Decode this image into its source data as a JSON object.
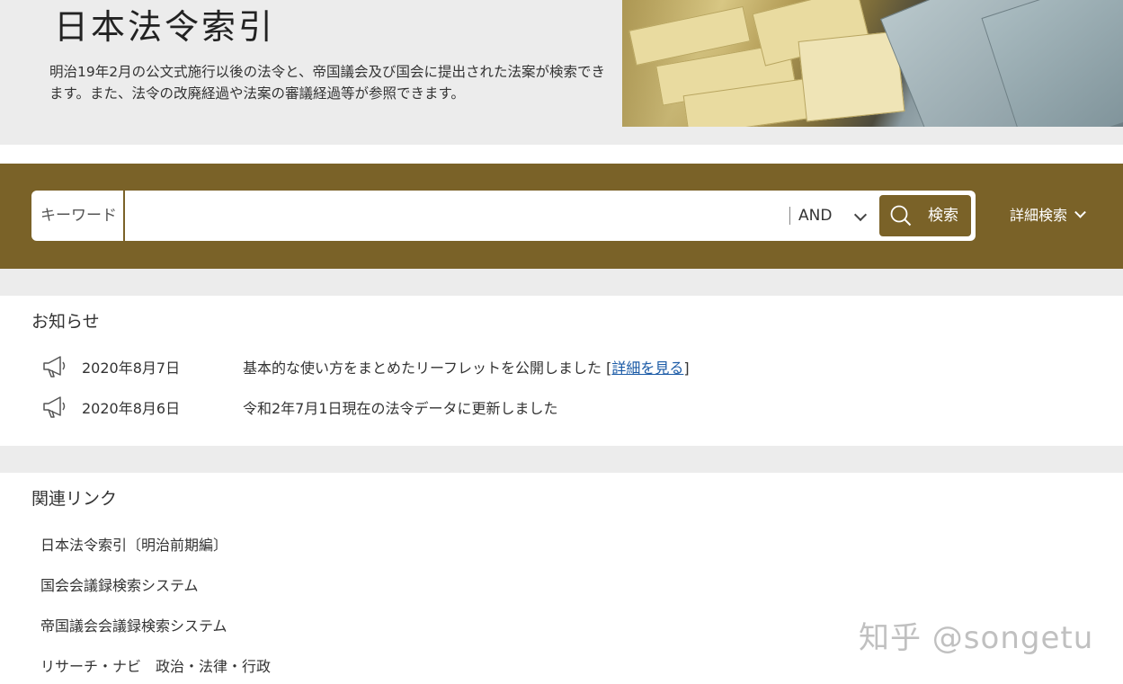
{
  "header": {
    "title": "日本法令索引",
    "description": "明治19年2月の公文式施行以後の法令と、帝国議会及び国会に提出された法案が検索できます。また、法令の改廃経過や法案の審議経過等が参照できます。"
  },
  "search": {
    "keyword_label": "キーワード",
    "keyword_value": "",
    "operator": "AND",
    "button_label": "検索",
    "advanced_label": "詳細検索"
  },
  "news": {
    "title": "お知らせ",
    "items": [
      {
        "date": "2020年8月7日",
        "text": "基本的な使い方をまとめたリーフレットを公開しました [",
        "link": "詳細を見る",
        "suffix": "]"
      },
      {
        "date": "2020年8月6日",
        "text": "令和2年7月1日現在の法令データに更新しました"
      }
    ]
  },
  "related": {
    "title": "関連リンク",
    "links": [
      "日本法令索引〔明治前期編〕",
      "国会会議録検索システム",
      "帝国議会会議録検索システム",
      "リサーチ・ナビ　政治・法律・行政"
    ]
  },
  "watermark": "知乎 @songetu",
  "colors": {
    "brand": "#7a6228",
    "header_bg": "#ececec",
    "link": "#1a5aa6"
  }
}
